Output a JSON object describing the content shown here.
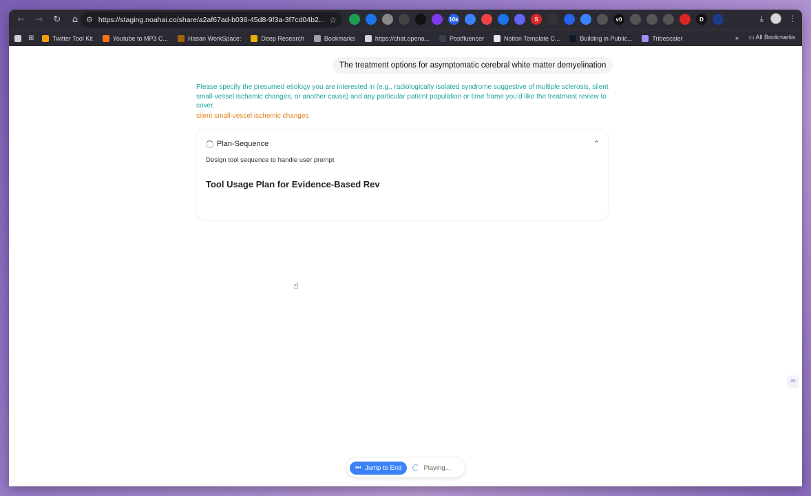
{
  "browser": {
    "url": "https://staging.noahai.co/share/a2af67ad-b036-45d8-9f3a-3f7cd04b2...",
    "extensions": [
      {
        "label": "",
        "color": "#1f9d55"
      },
      {
        "label": "",
        "color": "#1a73e8"
      },
      {
        "label": "",
        "color": "#888888"
      },
      {
        "label": "",
        "color": "#444444"
      },
      {
        "label": "",
        "color": "#111111"
      },
      {
        "label": "",
        "color": "#7c3aed"
      },
      {
        "label": "10k",
        "color": "#2563eb"
      },
      {
        "label": "",
        "color": "#3b82f6"
      },
      {
        "label": "",
        "color": "#ef4444"
      },
      {
        "label": "",
        "color": "#1a73e8"
      },
      {
        "label": "",
        "color": "#6366f1"
      },
      {
        "label": "S",
        "color": "#dc2626"
      },
      {
        "label": "",
        "color": "#333333"
      },
      {
        "label": "",
        "color": "#2563eb"
      },
      {
        "label": "",
        "color": "#3b82f6"
      },
      {
        "label": "",
        "color": "#555555"
      },
      {
        "label": "v0",
        "color": "#111111"
      },
      {
        "label": "",
        "color": "#555555"
      },
      {
        "label": "",
        "color": "#555555"
      },
      {
        "label": "",
        "color": "#555555"
      },
      {
        "label": "",
        "color": "#dc2626"
      },
      {
        "label": "D",
        "color": "#111111"
      },
      {
        "label": "",
        "color": "#1e3a8a"
      }
    ],
    "bookmarks": [
      {
        "label": "Twitter Tool Kit",
        "color": "#f59e0b"
      },
      {
        "label": "Youtube to MP3 C...",
        "color": "#f97316"
      },
      {
        "label": "Hasan WorkSpace:",
        "color": "#a16207"
      },
      {
        "label": "Deep Research",
        "color": "#eab308"
      },
      {
        "label": "Bookmarks",
        "color": "#9ca3af"
      },
      {
        "label": "https://chat.opena...",
        "color": "#d1d5db"
      },
      {
        "label": "Postfluencer",
        "color": "#374151"
      },
      {
        "label": "Notion Template C...",
        "color": "#e5e7eb"
      },
      {
        "label": "Building in Public...",
        "color": "#111827"
      },
      {
        "label": "Tribescaler",
        "color": "#a78bfa"
      }
    ],
    "all_bookmarks": "All Bookmarks",
    "more": "»"
  },
  "chat": {
    "user_message": "The treatment options for asymptomatic cerebral white matter demyelination",
    "assistant_question": "Please specify the presumed etiology you are interested in (e.g., radiologically isolated syndrome suggestive of multiple sclerosis, silent small-vessel ischemic changes, or another cause) and any particular patient population or time frame you’d like the treatment review to cover.",
    "user_answer": "silent small-vessel ischemic changes"
  },
  "plan": {
    "title": "Plan-Sequence",
    "subtitle": "Design tool sequence to handle user prompt",
    "heading": "Tool Usage Plan for Evidence-Based Rev"
  },
  "player": {
    "jump_label": "Jump to End",
    "status": "Playing..."
  },
  "colors": {
    "accent": "#3b82f6",
    "question_text": "#1aa3a0",
    "answer_text": "#e0801a"
  }
}
